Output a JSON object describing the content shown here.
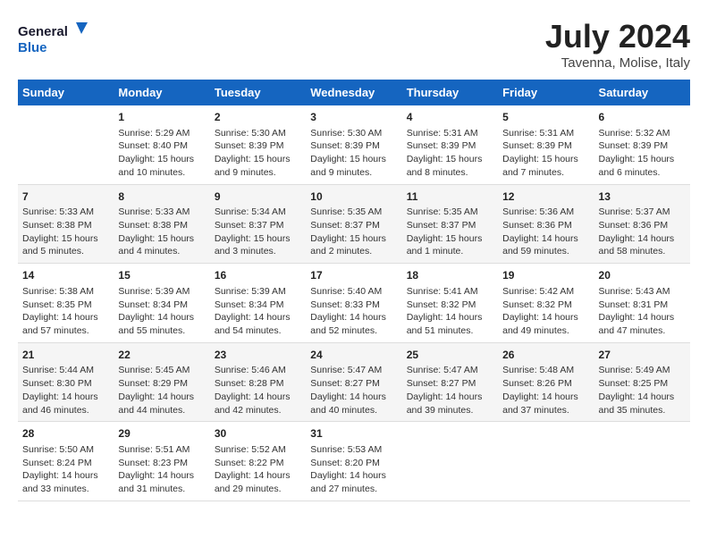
{
  "header": {
    "logo_line1": "General",
    "logo_line2": "Blue",
    "title": "July 2024",
    "subtitle": "Tavenna, Molise, Italy"
  },
  "days_of_week": [
    "Sunday",
    "Monday",
    "Tuesday",
    "Wednesday",
    "Thursday",
    "Friday",
    "Saturday"
  ],
  "weeks": [
    [
      {
        "day": "",
        "info": ""
      },
      {
        "day": "1",
        "info": "Sunrise: 5:29 AM\nSunset: 8:40 PM\nDaylight: 15 hours\nand 10 minutes."
      },
      {
        "day": "2",
        "info": "Sunrise: 5:30 AM\nSunset: 8:39 PM\nDaylight: 15 hours\nand 9 minutes."
      },
      {
        "day": "3",
        "info": "Sunrise: 5:30 AM\nSunset: 8:39 PM\nDaylight: 15 hours\nand 9 minutes."
      },
      {
        "day": "4",
        "info": "Sunrise: 5:31 AM\nSunset: 8:39 PM\nDaylight: 15 hours\nand 8 minutes."
      },
      {
        "day": "5",
        "info": "Sunrise: 5:31 AM\nSunset: 8:39 PM\nDaylight: 15 hours\nand 7 minutes."
      },
      {
        "day": "6",
        "info": "Sunrise: 5:32 AM\nSunset: 8:39 PM\nDaylight: 15 hours\nand 6 minutes."
      }
    ],
    [
      {
        "day": "7",
        "info": "Sunrise: 5:33 AM\nSunset: 8:38 PM\nDaylight: 15 hours\nand 5 minutes."
      },
      {
        "day": "8",
        "info": "Sunrise: 5:33 AM\nSunset: 8:38 PM\nDaylight: 15 hours\nand 4 minutes."
      },
      {
        "day": "9",
        "info": "Sunrise: 5:34 AM\nSunset: 8:37 PM\nDaylight: 15 hours\nand 3 minutes."
      },
      {
        "day": "10",
        "info": "Sunrise: 5:35 AM\nSunset: 8:37 PM\nDaylight: 15 hours\nand 2 minutes."
      },
      {
        "day": "11",
        "info": "Sunrise: 5:35 AM\nSunset: 8:37 PM\nDaylight: 15 hours\nand 1 minute."
      },
      {
        "day": "12",
        "info": "Sunrise: 5:36 AM\nSunset: 8:36 PM\nDaylight: 14 hours\nand 59 minutes."
      },
      {
        "day": "13",
        "info": "Sunrise: 5:37 AM\nSunset: 8:36 PM\nDaylight: 14 hours\nand 58 minutes."
      }
    ],
    [
      {
        "day": "14",
        "info": "Sunrise: 5:38 AM\nSunset: 8:35 PM\nDaylight: 14 hours\nand 57 minutes."
      },
      {
        "day": "15",
        "info": "Sunrise: 5:39 AM\nSunset: 8:34 PM\nDaylight: 14 hours\nand 55 minutes."
      },
      {
        "day": "16",
        "info": "Sunrise: 5:39 AM\nSunset: 8:34 PM\nDaylight: 14 hours\nand 54 minutes."
      },
      {
        "day": "17",
        "info": "Sunrise: 5:40 AM\nSunset: 8:33 PM\nDaylight: 14 hours\nand 52 minutes."
      },
      {
        "day": "18",
        "info": "Sunrise: 5:41 AM\nSunset: 8:32 PM\nDaylight: 14 hours\nand 51 minutes."
      },
      {
        "day": "19",
        "info": "Sunrise: 5:42 AM\nSunset: 8:32 PM\nDaylight: 14 hours\nand 49 minutes."
      },
      {
        "day": "20",
        "info": "Sunrise: 5:43 AM\nSunset: 8:31 PM\nDaylight: 14 hours\nand 47 minutes."
      }
    ],
    [
      {
        "day": "21",
        "info": "Sunrise: 5:44 AM\nSunset: 8:30 PM\nDaylight: 14 hours\nand 46 minutes."
      },
      {
        "day": "22",
        "info": "Sunrise: 5:45 AM\nSunset: 8:29 PM\nDaylight: 14 hours\nand 44 minutes."
      },
      {
        "day": "23",
        "info": "Sunrise: 5:46 AM\nSunset: 8:28 PM\nDaylight: 14 hours\nand 42 minutes."
      },
      {
        "day": "24",
        "info": "Sunrise: 5:47 AM\nSunset: 8:27 PM\nDaylight: 14 hours\nand 40 minutes."
      },
      {
        "day": "25",
        "info": "Sunrise: 5:47 AM\nSunset: 8:27 PM\nDaylight: 14 hours\nand 39 minutes."
      },
      {
        "day": "26",
        "info": "Sunrise: 5:48 AM\nSunset: 8:26 PM\nDaylight: 14 hours\nand 37 minutes."
      },
      {
        "day": "27",
        "info": "Sunrise: 5:49 AM\nSunset: 8:25 PM\nDaylight: 14 hours\nand 35 minutes."
      }
    ],
    [
      {
        "day": "28",
        "info": "Sunrise: 5:50 AM\nSunset: 8:24 PM\nDaylight: 14 hours\nand 33 minutes."
      },
      {
        "day": "29",
        "info": "Sunrise: 5:51 AM\nSunset: 8:23 PM\nDaylight: 14 hours\nand 31 minutes."
      },
      {
        "day": "30",
        "info": "Sunrise: 5:52 AM\nSunset: 8:22 PM\nDaylight: 14 hours\nand 29 minutes."
      },
      {
        "day": "31",
        "info": "Sunrise: 5:53 AM\nSunset: 8:20 PM\nDaylight: 14 hours\nand 27 minutes."
      },
      {
        "day": "",
        "info": ""
      },
      {
        "day": "",
        "info": ""
      },
      {
        "day": "",
        "info": ""
      }
    ]
  ]
}
